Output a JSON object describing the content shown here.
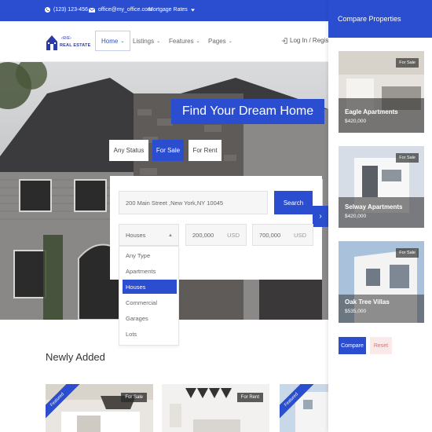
{
  "topbar": {
    "phone": "(123) 123-456",
    "email": "office@my_office.com",
    "mortgage_rates": "Mortgage Rates",
    "phone_icon": "phone-icon",
    "email_icon": "envelope-icon",
    "dropdown_icon": "caret-down-icon"
  },
  "brand": {
    "logo_top": "‹R/E›",
    "logo_name": "REAL ESTATE"
  },
  "nav": [
    {
      "label": "Home"
    },
    {
      "label": "Listings"
    },
    {
      "label": "Features"
    },
    {
      "label": "Pages"
    }
  ],
  "header": {
    "login": "Log In / Register"
  },
  "hero": {
    "title": "Find Your Dream Home",
    "status_tabs": [
      "Any Status",
      "For Sale",
      "For Rent"
    ],
    "active_status": "For Sale",
    "address_value": "200 Main Street ,New York,NY 10045",
    "search_button": "Search",
    "type_select_value": "Houses",
    "type_options": [
      "Any Type",
      "Apartments",
      "Houses",
      "Commercial",
      "Garages",
      "Lots"
    ],
    "selected_type": "Houses",
    "price_min": "200,000",
    "price_max": "700,000",
    "currency": "USD"
  },
  "newly_added": {
    "title": "Newly Added",
    "cards": [
      {
        "ribbon": "Featured",
        "tag": "For Sale"
      },
      {
        "ribbon": "",
        "tag": "For Rent"
      },
      {
        "ribbon": "Featured",
        "tag": ""
      }
    ]
  },
  "compare": {
    "title": "Compare Properties",
    "properties": [
      {
        "name": "Eagle Apartments",
        "price": "$420,000",
        "tag": "For Sale"
      },
      {
        "name": "Selway Apartments",
        "price": "$420,000",
        "tag": "For Sale"
      },
      {
        "name": "Oak Tree Villas",
        "price": "$535,000",
        "tag": "For Sale"
      }
    ],
    "compare_button": "Compare",
    "reset_button": "Reset"
  },
  "colors": {
    "accent": "#2a4ecf",
    "reset_bg": "#fbe9e9",
    "reset_text": "#e86b6b"
  }
}
